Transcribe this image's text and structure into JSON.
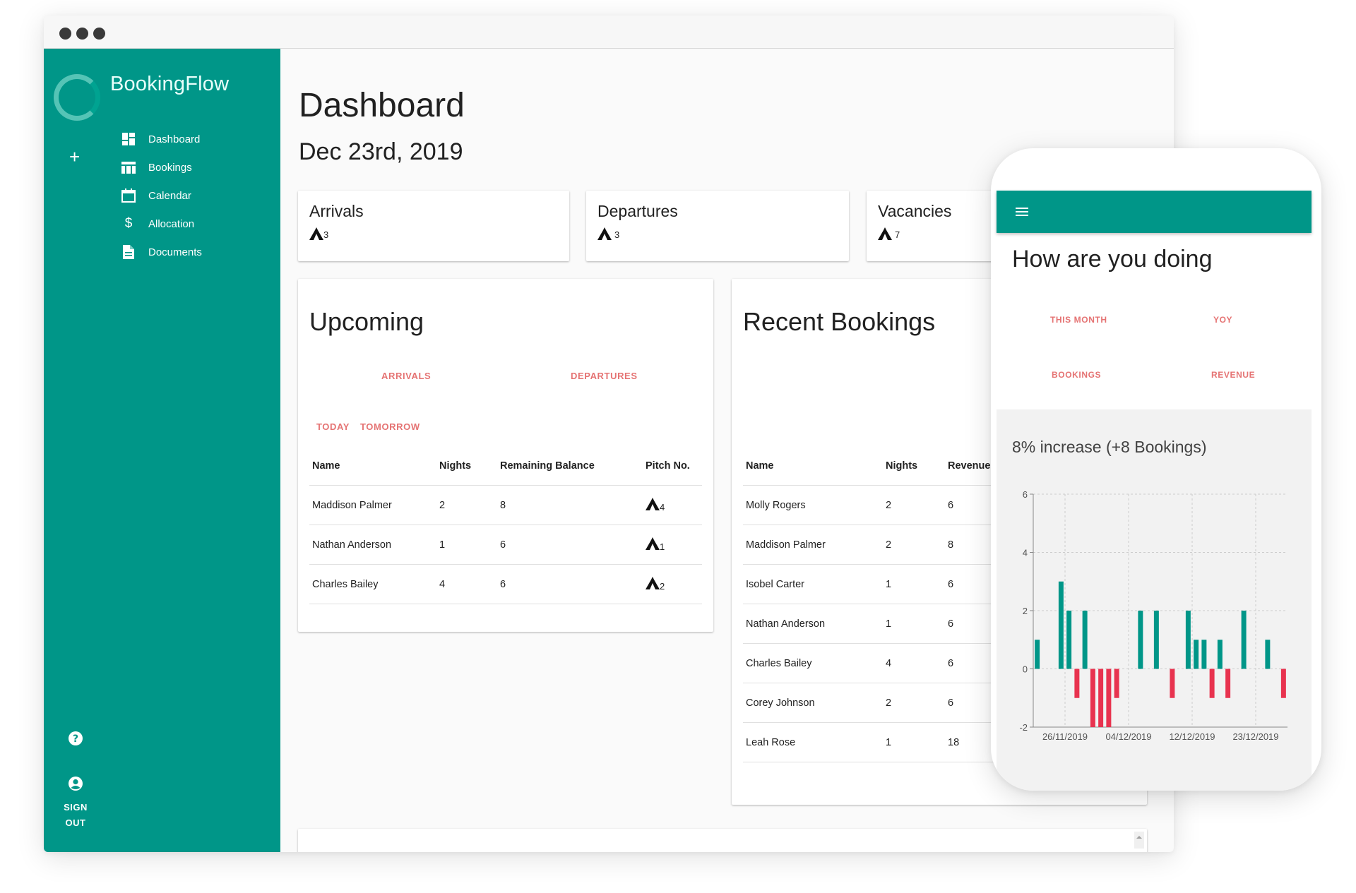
{
  "sidebar": {
    "brand": "BookingFlow",
    "items": [
      {
        "label": "Dashboard",
        "icon": "dashboard-icon"
      },
      {
        "label": "Bookings",
        "icon": "table-icon"
      },
      {
        "label": "Calendar",
        "icon": "calendar-icon"
      },
      {
        "label": "Allocation",
        "icon": "dollar-icon"
      },
      {
        "label": "Documents",
        "icon": "document-icon"
      }
    ],
    "plus_label": "+",
    "signout_line1": "SIGN",
    "signout_line2": "OUT"
  },
  "header": {
    "title": "Dashboard",
    "date": "Dec 23rd, 2019"
  },
  "stats": [
    {
      "label": "Arrivals",
      "value": "3"
    },
    {
      "label": "Departures",
      "value": "3"
    },
    {
      "label": "Vacancies",
      "value": "7"
    }
  ],
  "upcoming": {
    "title": "Upcoming",
    "tabs": [
      "ARRIVALS",
      "DEPARTURES"
    ],
    "subtabs": [
      "TODAY",
      "TOMORROW"
    ],
    "columns": [
      "Name",
      "Nights",
      "Remaining Balance",
      "Pitch No."
    ],
    "rows": [
      {
        "name": "Maddison Palmer",
        "nights": "2",
        "balance": "8",
        "pitch": "4"
      },
      {
        "name": "Nathan Anderson",
        "nights": "1",
        "balance": "6",
        "pitch": "1"
      },
      {
        "name": "Charles Bailey",
        "nights": "4",
        "balance": "6",
        "pitch": "2"
      }
    ]
  },
  "recent": {
    "title": "Recent Bookings",
    "columns": [
      "Name",
      "Nights",
      "Revenue"
    ],
    "rows": [
      {
        "name": "Molly Rogers",
        "nights": "2",
        "revenue": "6"
      },
      {
        "name": "Maddison Palmer",
        "nights": "2",
        "revenue": "8"
      },
      {
        "name": "Isobel Carter",
        "nights": "1",
        "revenue": "6"
      },
      {
        "name": "Nathan Anderson",
        "nights": "1",
        "revenue": "6"
      },
      {
        "name": "Charles Bailey",
        "nights": "4",
        "revenue": "6"
      },
      {
        "name": "Corey Johnson",
        "nights": "2",
        "revenue": "6"
      },
      {
        "name": "Leah Rose",
        "nights": "1",
        "revenue": "18"
      }
    ]
  },
  "phone": {
    "heading": "How are you doing",
    "tabs_top": [
      "THIS MONTH",
      "YOY"
    ],
    "tabs_bottom": [
      "BOOKINGS",
      "REVENUE"
    ],
    "increase_text": "8% increase (+8 Bookings)"
  },
  "colors": {
    "primary": "#009688",
    "accent": "#e57373",
    "positive_bar": "#009688",
    "negative_bar": "#e8334f"
  },
  "chart_data": {
    "type": "bar",
    "ylim": [
      -2,
      6
    ],
    "yticks": [
      -2,
      0,
      2,
      4,
      6
    ],
    "xticks": [
      "26/11/2019",
      "04/12/2019",
      "12/12/2019",
      "23/12/2019"
    ],
    "grid": true,
    "xlabel": "",
    "ylabel": "",
    "values": [
      1,
      0,
      0,
      3,
      2,
      -1,
      2,
      -2,
      -2,
      -2,
      -1,
      0,
      0,
      2,
      0,
      2,
      0,
      -1,
      0,
      2,
      1,
      1,
      -1,
      1,
      -1,
      0,
      2,
      0,
      0,
      1,
      0,
      -1
    ]
  }
}
